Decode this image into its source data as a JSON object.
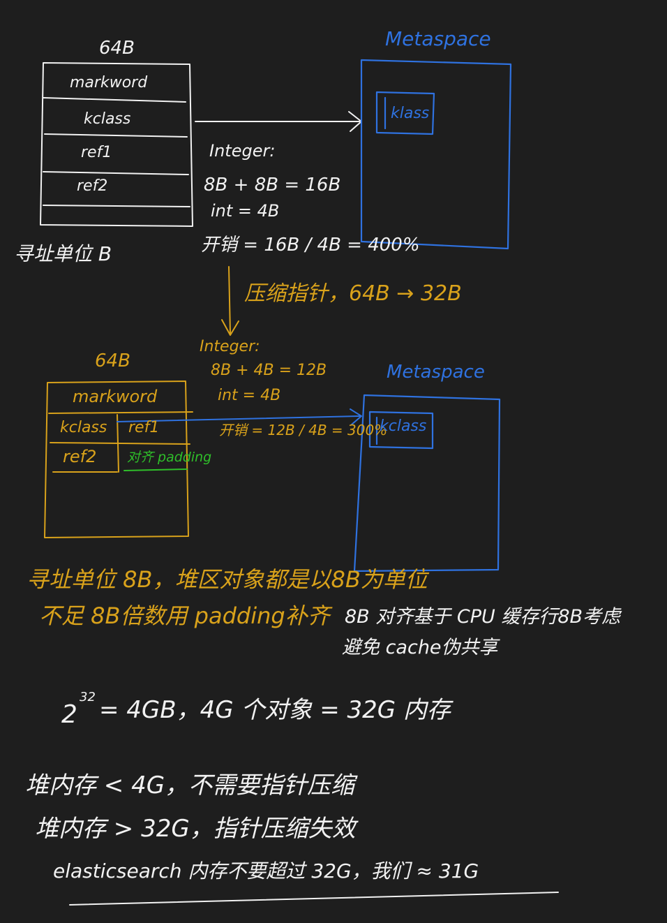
{
  "colors": {
    "background": "#1e1e1e",
    "white_ink": "#f2f2f2",
    "blue_ink": "#2f72e0",
    "orange_ink": "#d9a21b",
    "green_ink": "#2fbf2a"
  },
  "top_object": {
    "size_label": "64B",
    "fields": [
      "markword",
      "kclass",
      "ref1",
      "ref2"
    ],
    "unit_note": "寻址单位 B"
  },
  "top_metaspace": {
    "title": "Metaspace",
    "klass": "klass"
  },
  "top_integer": {
    "lines": [
      "Integer:",
      "8B + 8B = 16B",
      "int = 4B",
      "开销 = 16B / 4B = 400%"
    ]
  },
  "compression_note": "压缩指针，64B → 32B",
  "bottom_object": {
    "size_label": "64B",
    "markword": "markword",
    "kclass": "kclass",
    "ref1": "ref1",
    "ref2": "ref2",
    "padding": "对齐 padding"
  },
  "bottom_integer": {
    "lines": [
      "Integer:",
      "8B + 4B = 12B",
      "int = 4B",
      "开销 = 12B / 4B = 300%"
    ]
  },
  "bottom_metaspace": {
    "title": "Metaspace",
    "klass": "kclass"
  },
  "notes_orange": [
    "寻址单位 8B，堆区对象都是以8B为单位",
    "不足 8B倍数用 padding补齐"
  ],
  "notes_white": [
    "8B 对齐基于 CPU 缓存行8B考虑",
    "避免 cache伪共享"
  ],
  "formula": {
    "base": "2",
    "exponent": "32",
    "rest": "= 4GB，4G 个对象 = 32G 内存"
  },
  "bottom_notes": [
    "堆内存 < 4G，不需要指针压缩",
    "堆内存 > 32G，指针压缩失效",
    "elasticsearch 内存不要超过 32G，我们 ≈ 31G"
  ]
}
